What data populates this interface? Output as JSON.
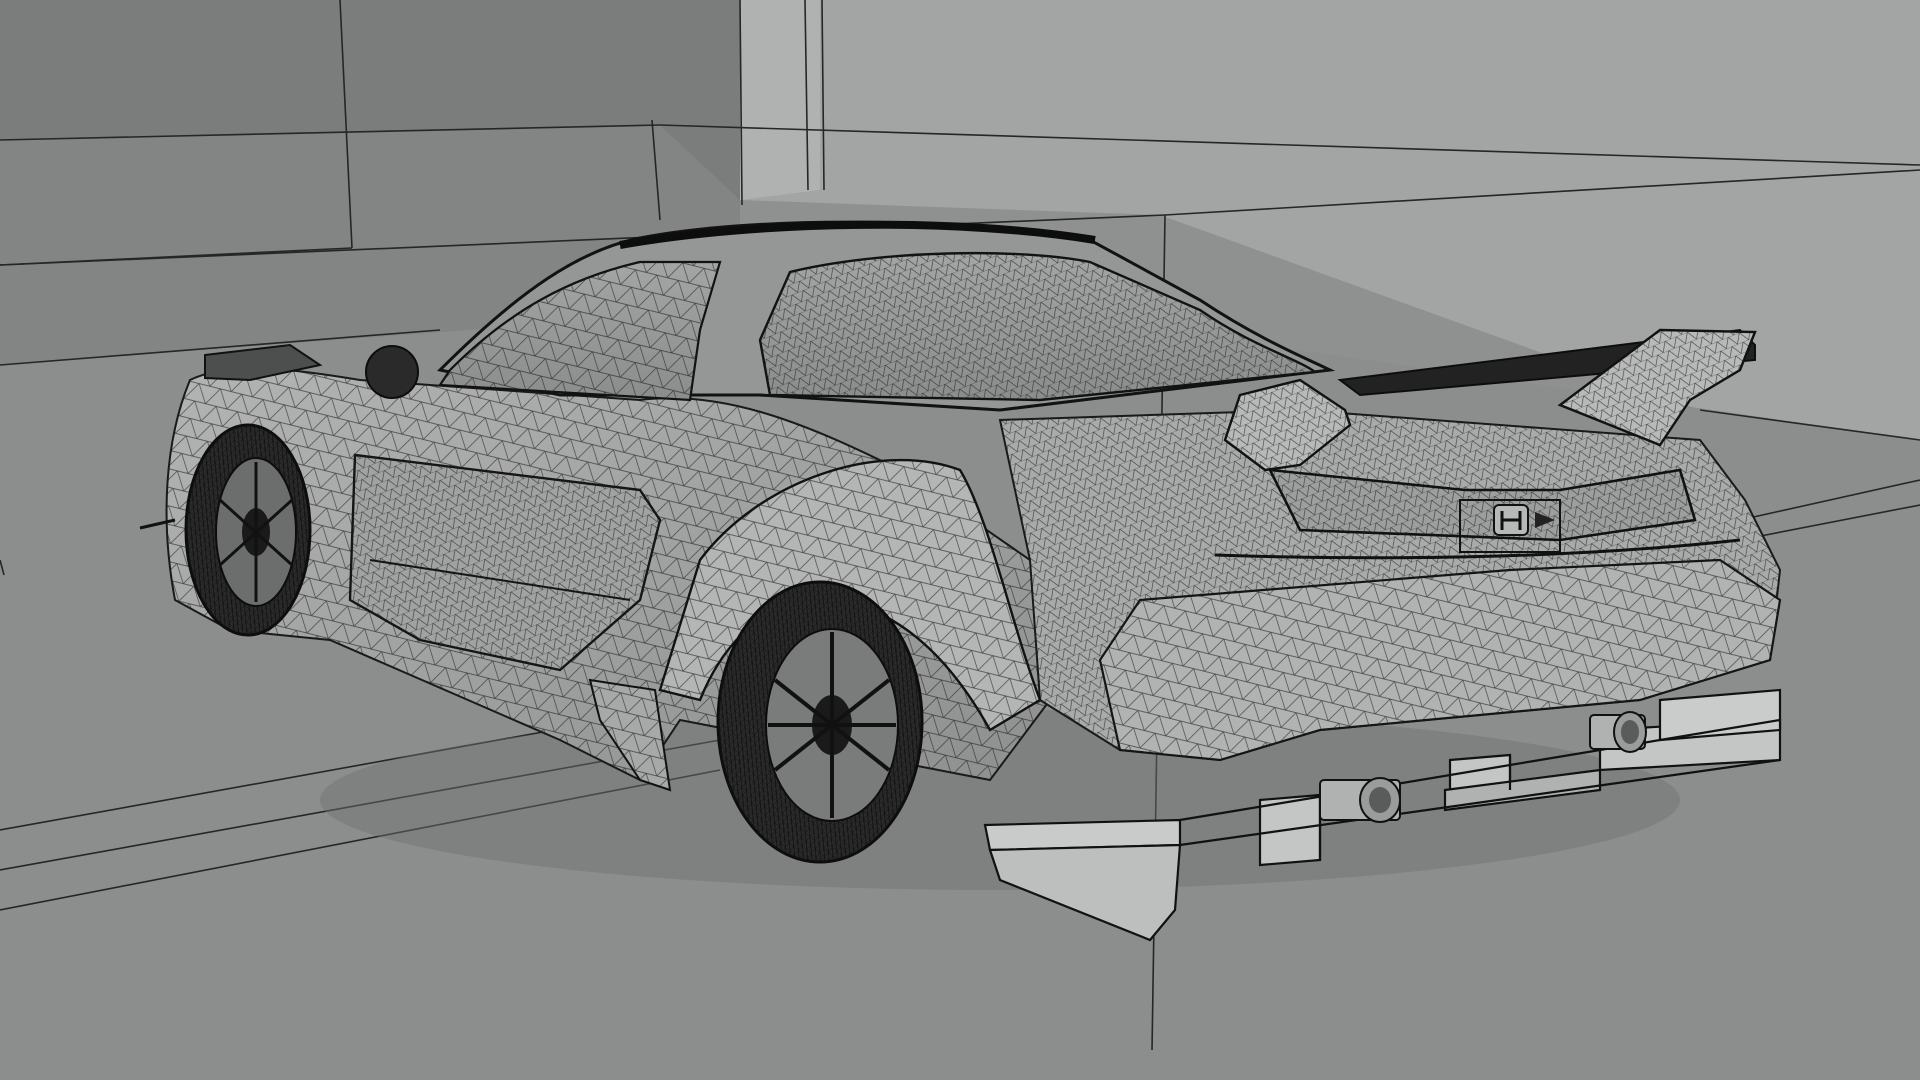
{
  "scene": {
    "subject": "wireframe-sports-car-rear-three-quarter",
    "view": "3d-viewport-wireframe-on-shaded",
    "colors": {
      "background_far": "#7b7c7c",
      "wall_back": "#8a8b8b",
      "wall_right": "#a3a4a4",
      "floor": "#8f9090",
      "car_body": "#a7a8a8",
      "car_shadow": "#6f7070",
      "wire": "#1c1c1c",
      "grid_line": "#2a2a2a",
      "tire": "#2b2b2b",
      "glass": "#9c9d9d"
    },
    "badge_icon": "honda-h-emblem-icon"
  }
}
